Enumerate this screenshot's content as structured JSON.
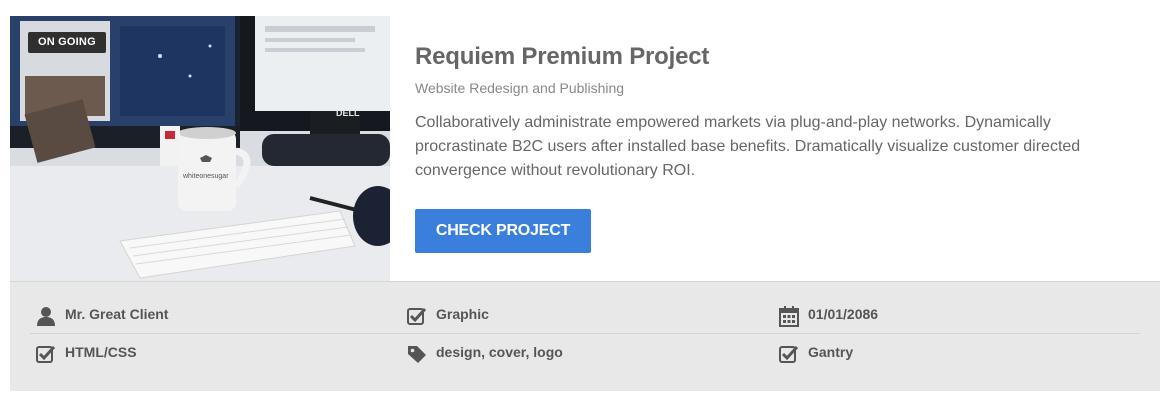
{
  "project": {
    "badge": "ON GOING",
    "title": "Requiem Premium Project",
    "subtitle": "Website Redesign and Publishing",
    "description": "Collaboratively administrate empowered markets via plug-and-play networks. Dynamically procrastinate B2C users after installed base benefits. Dramatically visualize customer directed convergence without revolutionary ROI.",
    "button_label": "CHECK PROJECT"
  },
  "meta": {
    "client": {
      "icon": "user-icon",
      "text": "Mr. Great Client"
    },
    "category": {
      "icon": "checkbox-icon",
      "text": "Graphic"
    },
    "date": {
      "icon": "calendar-icon",
      "text": "01/01/2086"
    },
    "tech": {
      "icon": "checkbox-icon",
      "text": "HTML/CSS"
    },
    "tags": {
      "icon": "tag-icon",
      "text": "design, cover, logo"
    },
    "framework": {
      "icon": "checkbox-icon",
      "text": "Gantry"
    }
  },
  "colors": {
    "button": "#3b7fdc",
    "badge": "#2f2f2f",
    "meta_bg": "#e8e8e8"
  }
}
